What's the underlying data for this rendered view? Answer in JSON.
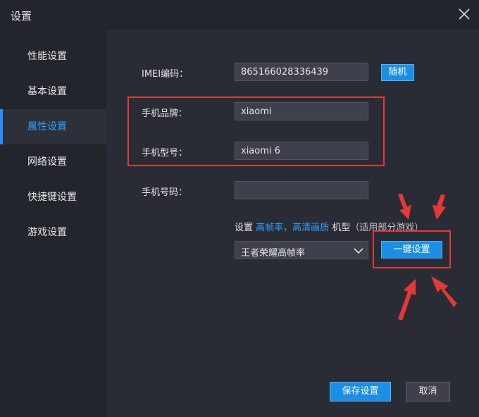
{
  "window": {
    "title": "设置"
  },
  "sidebar": {
    "items": [
      {
        "label": "性能设置"
      },
      {
        "label": "基本设置"
      },
      {
        "label": "属性设置"
      },
      {
        "label": "网络设置"
      },
      {
        "label": "快捷键设置"
      },
      {
        "label": "游戏设置"
      }
    ],
    "active_index": 2
  },
  "form": {
    "imei": {
      "label": "IMEI编码：",
      "value": "865166028336439",
      "random_label": "随机"
    },
    "brand": {
      "label": "手机品牌：",
      "value": "xiaomi"
    },
    "model": {
      "label": "手机型号：",
      "value": "xiaomi 6"
    },
    "phone": {
      "label": "手机号码：",
      "value": ""
    }
  },
  "preset": {
    "hint_prefix": "设置 ",
    "hint_highlight": "高帧率，高清画质",
    "hint_mid": " 机型",
    "hint_suffix": "（适用部分游戏）",
    "selected": "王者荣耀高帧率",
    "apply_label": "一键设置"
  },
  "footer": {
    "save_label": "保存设置",
    "cancel_label": "取消"
  },
  "colors": {
    "accent": "#2fa0ff",
    "button": "#1a8fe3",
    "annotation": "#e53935",
    "background": "#2a2c35",
    "sidebar": "#23252d"
  },
  "icons": {
    "close": "close-icon",
    "dropdown": "chevron-down-icon"
  }
}
